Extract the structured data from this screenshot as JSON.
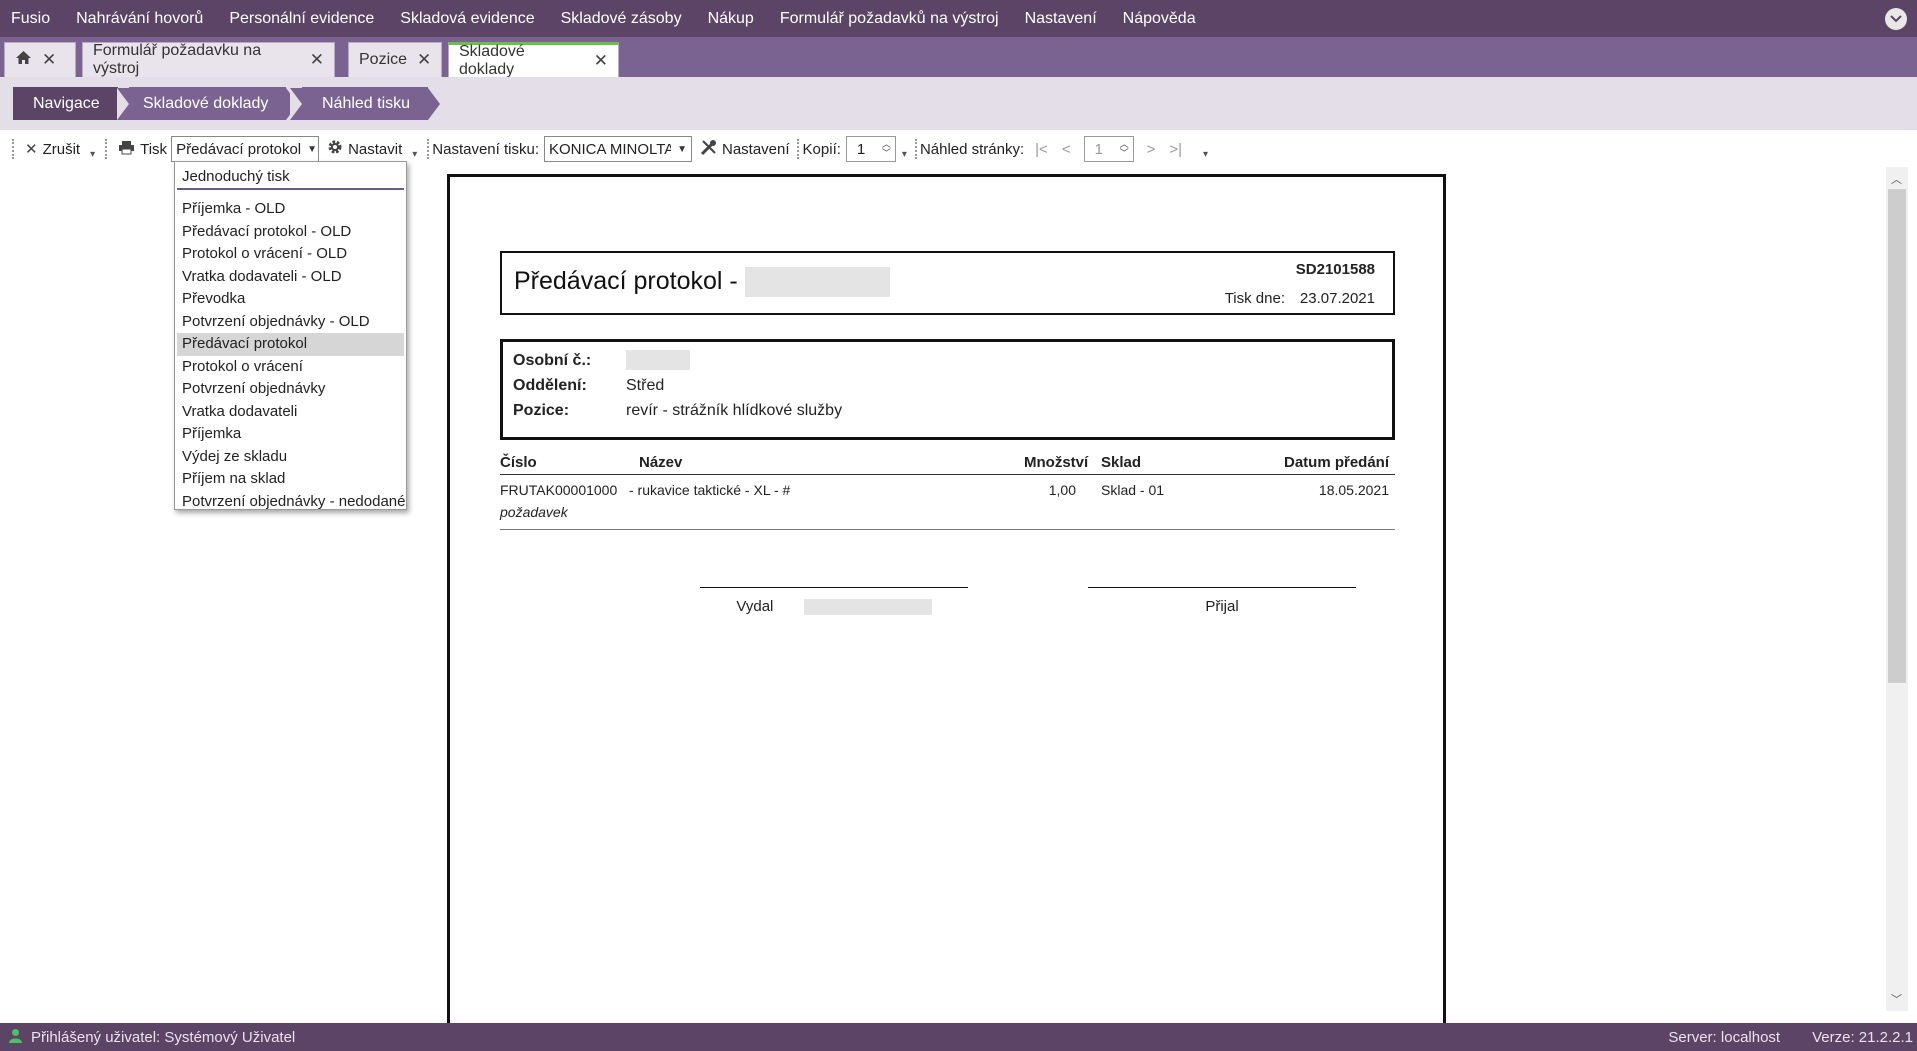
{
  "menu": [
    "Fusio",
    "Nahrávání hovorů",
    "Personální evidence",
    "Skladová evidence",
    "Skladové zásoby",
    "Nákup",
    "Formulář požadavků na výstroj",
    "Nastavení",
    "Nápověda"
  ],
  "tabs": {
    "home_icon": "home-icon",
    "items": [
      {
        "label": "Formulář požadavku na výstroj"
      },
      {
        "label": "Pozice"
      },
      {
        "label": "Skladové doklady"
      }
    ],
    "active": "Skladové doklady",
    "close_glyph": "✕"
  },
  "breadcrumb": [
    "Navigace",
    "Skladové doklady",
    "Náhled tisku"
  ],
  "colors": {
    "chrome": "#5b4466",
    "tab_strip": "#7a6390",
    "crumb_dark": "#5b4466",
    "crumb_light": "#7a6390",
    "accent_green": "#6abf4b"
  },
  "toolbar": {
    "cancel_label": "Zrušit",
    "print_label": "Tisk",
    "report_selected": "Předávací protokol",
    "settings_label": "Nastavit",
    "print_settings_label": "Nastavení tisku:",
    "printer_value": "KONICA MINOLTA (",
    "printer_settings_label": "Nastavení",
    "copies_label": "Kopií:",
    "copies_value": "1",
    "page_preview_label": "Náhled stránky:",
    "page_value": "1"
  },
  "dropdown": {
    "first": "Jednoduchý tisk",
    "items": [
      "Příjemka - OLD",
      "Předávací protokol - OLD",
      "Protokol o vrácení - OLD",
      "Vratka dodavateli - OLD",
      "Převodka",
      "Potvrzení objednávky - OLD",
      "Předávací protokol",
      "Protokol o vrácení",
      "Potvrzení objednávky",
      "Vratka dodavateli",
      "Příjemka",
      "Výdej ze skladu",
      "Příjem na sklad",
      "Potvrzení objednávky - nedodané"
    ],
    "selected": "Předávací protokol"
  },
  "document": {
    "title": "Předávací protokol -",
    "number": "SD2101588",
    "print_date_label": "Tisk dne:",
    "print_date": "23.07.2021",
    "personal_no_label": "Osobní č.:",
    "department_label": "Oddělení:",
    "department": "Střed",
    "position_label": "Pozice:",
    "position": "revír - strážník hlídkové služby",
    "table": {
      "headers": [
        "Číslo",
        "Název",
        "Množství",
        "Sklad",
        "Datum předání"
      ],
      "rows": [
        {
          "cislo": "FRUTAK00001000",
          "nazev": "- rukavice taktické - XL - #",
          "mnozstvi": "1,00",
          "sklad": "Sklad - 01",
          "datum": "18.05.2021"
        }
      ],
      "note": "požadavek"
    },
    "issued_label": "Vydal",
    "received_label": "Přijal"
  },
  "status": {
    "user": "Přihlášený uživatel: Systémový Uživatel",
    "server": "Server: localhost",
    "version": "Verze: 21.2.2.1"
  }
}
